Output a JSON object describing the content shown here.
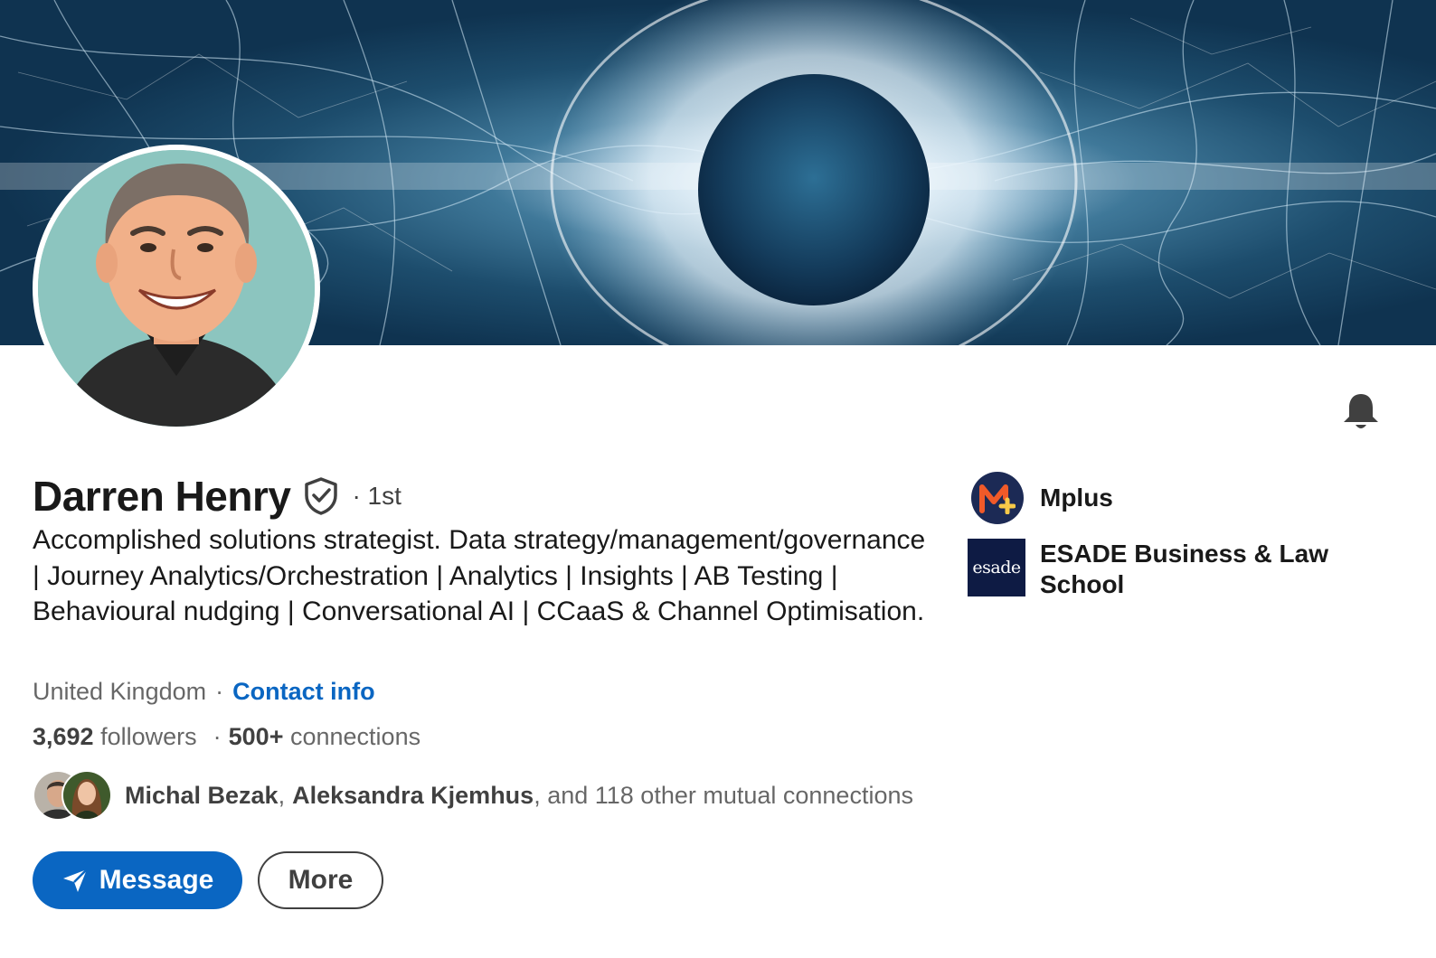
{
  "profile": {
    "name": "Darren Henry",
    "degree": "· 1st",
    "headline": "Accomplished solutions strategist. Data strategy/management/governance | Journey Analytics/Orchestration | Analytics | Insights | AB Testing | Behavioural nudging | Conversational AI | CCaaS & Channel Optimisation.",
    "location": "United Kingdom",
    "location_separator": "·",
    "contact_label": "Contact info",
    "followers_count": "3,692",
    "followers_label": "followers",
    "stats_separator": "·",
    "connections_count": "500+",
    "connections_label": "connections"
  },
  "mutual": {
    "first": "Michal Bezak",
    "comma": ",",
    "second": "Aleksandra Kjemhus",
    "rest": ", and 118 other mutual connections"
  },
  "actions": {
    "message_label": "Message",
    "more_label": "More"
  },
  "organizations": [
    {
      "name": "Mplus",
      "logo_text": "M"
    },
    {
      "name": "ESADE Business & Law School",
      "logo_text": "esade"
    }
  ],
  "icons": {
    "verified": "shield-check-icon",
    "bell": "bell-icon",
    "send": "paper-plane-icon"
  },
  "colors": {
    "accent": "#0a66c2",
    "muted_text": "#00000099",
    "esade_navy": "#0e1b44",
    "mplus_navy": "#1c2a55",
    "mplus_orange": "#f15a29",
    "mplus_yellow": "#f7c948"
  }
}
